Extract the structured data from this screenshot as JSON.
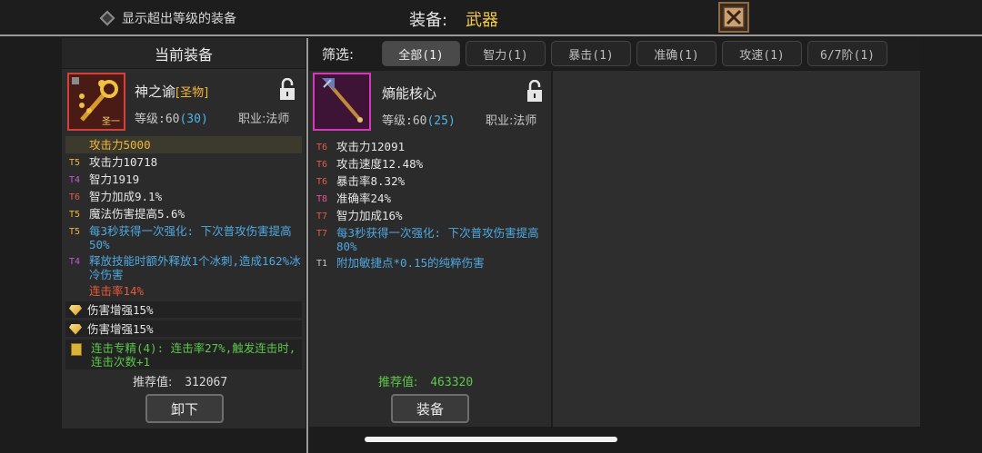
{
  "topbar": {
    "show_over_level": "显示超出等级的装备",
    "title_label": "装备:",
    "title_value": "武器"
  },
  "left": {
    "header": "当前装备",
    "item": {
      "name": "神之谕",
      "tag": "[圣物]",
      "level_label": "等级:",
      "level": "60",
      "level_extra": "(30)",
      "class": "职业:法师",
      "icon": "holy-staff-icon",
      "badge": "圣一"
    },
    "stats": [
      {
        "tier": "",
        "text": "攻击力5000",
        "color": "#f0b63c",
        "style": "highlight"
      },
      {
        "tier": "T5",
        "text": "攻击力10718",
        "color": "#e6e6e6",
        "tier_color": "#f0b63c"
      },
      {
        "tier": "T4",
        "text": "智力1919",
        "color": "#e6e6e6",
        "tier_color": "#c05ad8"
      },
      {
        "tier": "T6",
        "text": "智力加成9.1%",
        "color": "#e6e6e6",
        "tier_color": "#e85a4a"
      },
      {
        "tier": "T5",
        "text": "魔法伤害提高5.6%",
        "color": "#e6e6e6",
        "tier_color": "#f0b63c"
      },
      {
        "tier": "T5",
        "text": "每3秒获得一次强化: 下次普攻伤害提高50%",
        "color": "#4fa8e0",
        "tier_color": "#f0b63c"
      },
      {
        "tier": "T4",
        "text": "释放技能时额外释放1个冰刺,造成162%冰冷伤害",
        "color": "#4fa8e0",
        "tier_color": "#c05ad8"
      },
      {
        "tier": "",
        "text": "连击率14%",
        "color": "#e85a3a"
      }
    ],
    "gems": [
      {
        "text": "伤害增强15%"
      },
      {
        "text": "伤害增强15%"
      }
    ],
    "set_bonus": "连击专精(4): 连击率27%,触发连击时,连击次数+1",
    "recommend_label": "推荐值:",
    "recommend_value": "312067",
    "unequip_button": "卸下"
  },
  "filter": {
    "label": "筛选:",
    "tabs": [
      {
        "label": "全部(1)",
        "active": true
      },
      {
        "label": "智力(1)",
        "active": false
      },
      {
        "label": "暴击(1)",
        "active": false
      },
      {
        "label": "准确(1)",
        "active": false
      },
      {
        "label": "攻速(1)",
        "active": false
      },
      {
        "label": "6/7阶(1)",
        "active": false
      }
    ]
  },
  "right": {
    "item": {
      "name": "熵能核心",
      "level_label": "等级:",
      "level": "60",
      "level_extra": "(25)",
      "class": "职业:法师",
      "icon": "dark-staff-icon"
    },
    "stats": [
      {
        "tier": "T6",
        "text": "攻击力12091",
        "color": "#e6e6e6",
        "tier_color": "#e85a4a"
      },
      {
        "tier": "T6",
        "text": "攻击速度12.48%",
        "color": "#e6e6e6",
        "tier_color": "#e85a4a"
      },
      {
        "tier": "T6",
        "text": "暴击率8.32%",
        "color": "#e6e6e6",
        "tier_color": "#e85a4a"
      },
      {
        "tier": "T8",
        "text": "准确率24%",
        "color": "#e6e6e6",
        "tier_color": "#e8559a"
      },
      {
        "tier": "T7",
        "text": "智力加成16%",
        "color": "#e6e6e6",
        "tier_color": "#e85a4a"
      },
      {
        "tier": "T7",
        "text": "每3秒获得一次强化: 下次普攻伤害提高80%",
        "color": "#4fa8e0",
        "tier_color": "#e85a4a"
      },
      {
        "tier": "T1",
        "text": "附加敏捷点*0.15的纯粹伤害",
        "color": "#4fa8e0",
        "tier_color": "#c8c8c8"
      }
    ],
    "recommend_label": "推荐值:",
    "recommend_value": "463320",
    "equip_button": "装备"
  }
}
